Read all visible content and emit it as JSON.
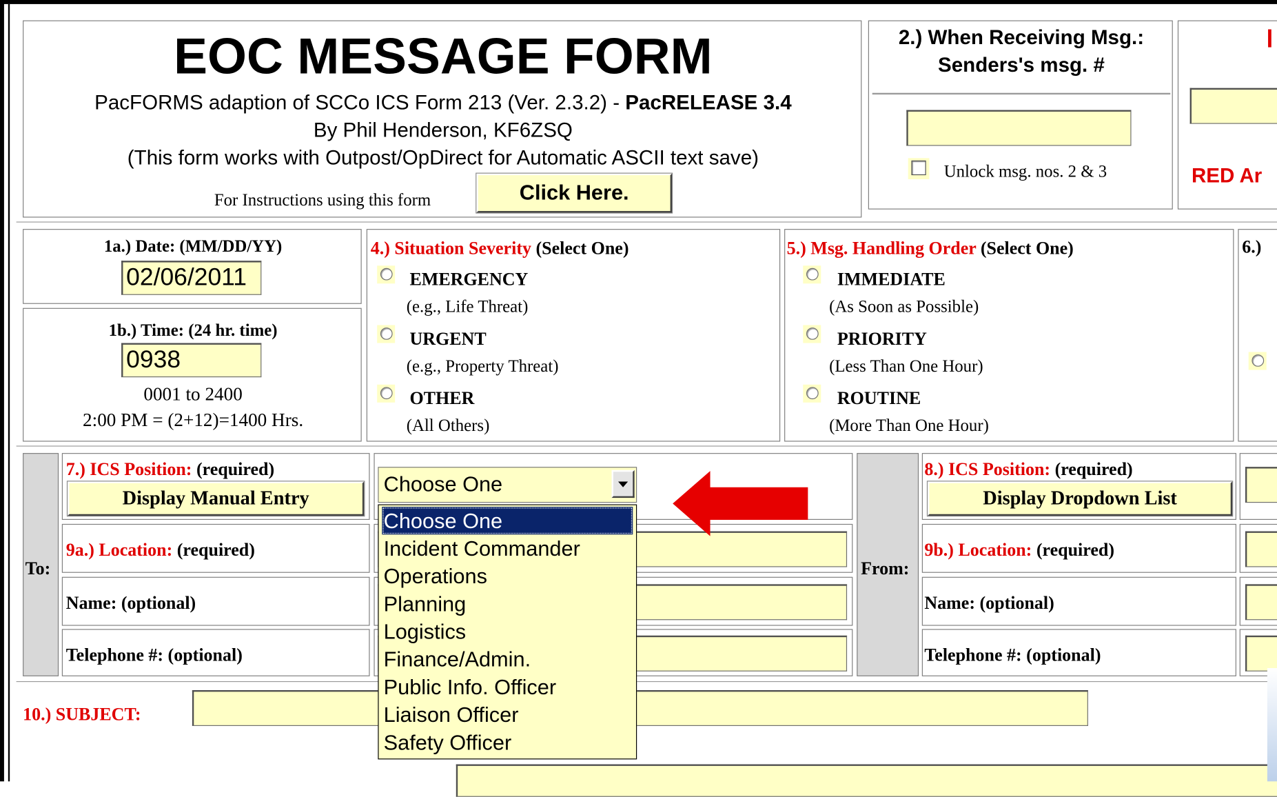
{
  "header": {
    "title": "EOC MESSAGE FORM",
    "adaption_text": "PacFORMS adaption of SCCo ICS Form 213 (Ver. 2.3.2) - ",
    "release": "PacRELEASE 3.4",
    "author": "By Phil Henderson, KF6ZSQ",
    "note": "(This form works with Outpost/OpDirect for Automatic ASCII text save)",
    "instructions_label": "For Instructions using this form",
    "click_here_button": "Click Here."
  },
  "receiving": {
    "title_line1": "2.) When Receiving Msg.:",
    "title_line2": "Senders's msg. #",
    "sender_msg_value": "",
    "unlock_label": "Unlock msg. nos. 2 & 3"
  },
  "right_edge": {
    "red_text": "RED Ar",
    "field_value": ""
  },
  "date": {
    "label": "1a.) Date: (MM/DD/YY)",
    "value": "02/06/2011"
  },
  "time": {
    "label": "1b.) Time: (24 hr. time)",
    "value": "0938",
    "range_hint": "0001 to 2400",
    "example_hint": "2:00 PM = (2+12)=1400 Hrs."
  },
  "severity": {
    "label_red": "4.) Situation Severity",
    "label_suffix": " (Select One)",
    "options": [
      {
        "label": "EMERGENCY",
        "hint": "(e.g., Life Threat)"
      },
      {
        "label": "URGENT",
        "hint": "(e.g., Property Threat)"
      },
      {
        "label": "OTHER",
        "hint": "(All Others)"
      }
    ]
  },
  "handling": {
    "label_red": "5.) Msg. Handling Order",
    "label_suffix": " (Select One)",
    "options": [
      {
        "label": "IMMEDIATE",
        "hint": "(As Soon as Possible)"
      },
      {
        "label": "PRIORITY",
        "hint": "(Less Than One Hour)"
      },
      {
        "label": "ROUTINE",
        "hint": "(More Than One Hour)"
      }
    ]
  },
  "section6": {
    "label": "6.) "
  },
  "to": {
    "side_label": "To:",
    "position_label_red": "7.) ICS Position:",
    "position_required": " (required)",
    "display_manual_button": "Display Manual Entry",
    "location_label_red": "9a.) Location:",
    "location_required": " (required)",
    "name_label": "Name: (optional)",
    "telephone_label": "Telephone #: (optional)",
    "position_select_value": "Choose One",
    "location_value": "",
    "name_value": "",
    "telephone_value": ""
  },
  "dropdown": {
    "options": [
      "Choose One",
      "Incident Commander",
      "Operations",
      "Planning",
      "Logistics",
      "Finance/Admin.",
      "Public Info. Officer",
      "Liaison Officer",
      "Safety Officer"
    ],
    "selected_index": 0
  },
  "from": {
    "side_label": "From:",
    "position_label_red": "8.) ICS Position:",
    "position_required": " (required)",
    "display_dropdown_button": "Display Dropdown List",
    "location_label_red": "9b.) Location:",
    "location_required": " (required)",
    "name_label": "Name: (optional)",
    "telephone_label": "Telephone #: (optional)"
  },
  "subject": {
    "label": "10.) SUBJECT:",
    "value": ""
  },
  "colors": {
    "input_bg": "#ffffc6",
    "required_red": "#e00000",
    "selection_blue": "#0a246a",
    "arrow_red": "#e60000"
  }
}
